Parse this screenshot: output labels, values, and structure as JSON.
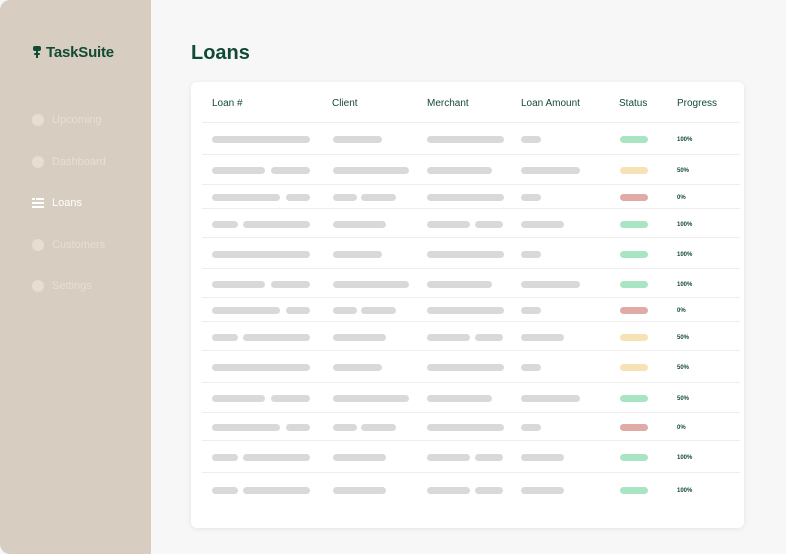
{
  "app": {
    "brand": "TaskSuite",
    "page_title": "Loans"
  },
  "sidebar": {
    "items": [
      {
        "label": "Upcoming",
        "icon": "circle-icon",
        "active": false
      },
      {
        "label": "Dashboard",
        "icon": "circle-icon",
        "active": false
      },
      {
        "label": "Loans",
        "icon": "list-lines-icon",
        "active": true
      },
      {
        "label": "Customers",
        "icon": "circle-icon",
        "active": false
      },
      {
        "label": "Settings",
        "icon": "circle-icon",
        "active": false
      }
    ]
  },
  "table": {
    "columns": [
      "Loan #",
      "Client",
      "Merchant",
      "Loan Amount",
      "Status",
      "Progress"
    ],
    "rows": [
      {
        "status": "green",
        "progress": "100%"
      },
      {
        "status": "yellow",
        "progress": "50%"
      },
      {
        "status": "red",
        "progress": "0%"
      },
      {
        "status": "green",
        "progress": "100%"
      },
      {
        "status": "green",
        "progress": "100%"
      },
      {
        "status": "green",
        "progress": "100%"
      },
      {
        "status": "red",
        "progress": "0%"
      },
      {
        "status": "yellow",
        "progress": "50%"
      },
      {
        "status": "yellow",
        "progress": "50%"
      },
      {
        "status": "green",
        "progress": "50%"
      },
      {
        "status": "red",
        "progress": "0%"
      },
      {
        "status": "green",
        "progress": "100%"
      },
      {
        "status": "green",
        "progress": "100%"
      }
    ]
  },
  "colors": {
    "sidebar_bg": "#d8cdc1",
    "brand_green": "#134a36",
    "status_green": "#a8e5c3",
    "status_yellow": "#f6e2b5",
    "status_red": "#e0aaa7",
    "placeholder": "#d9d9d9"
  }
}
